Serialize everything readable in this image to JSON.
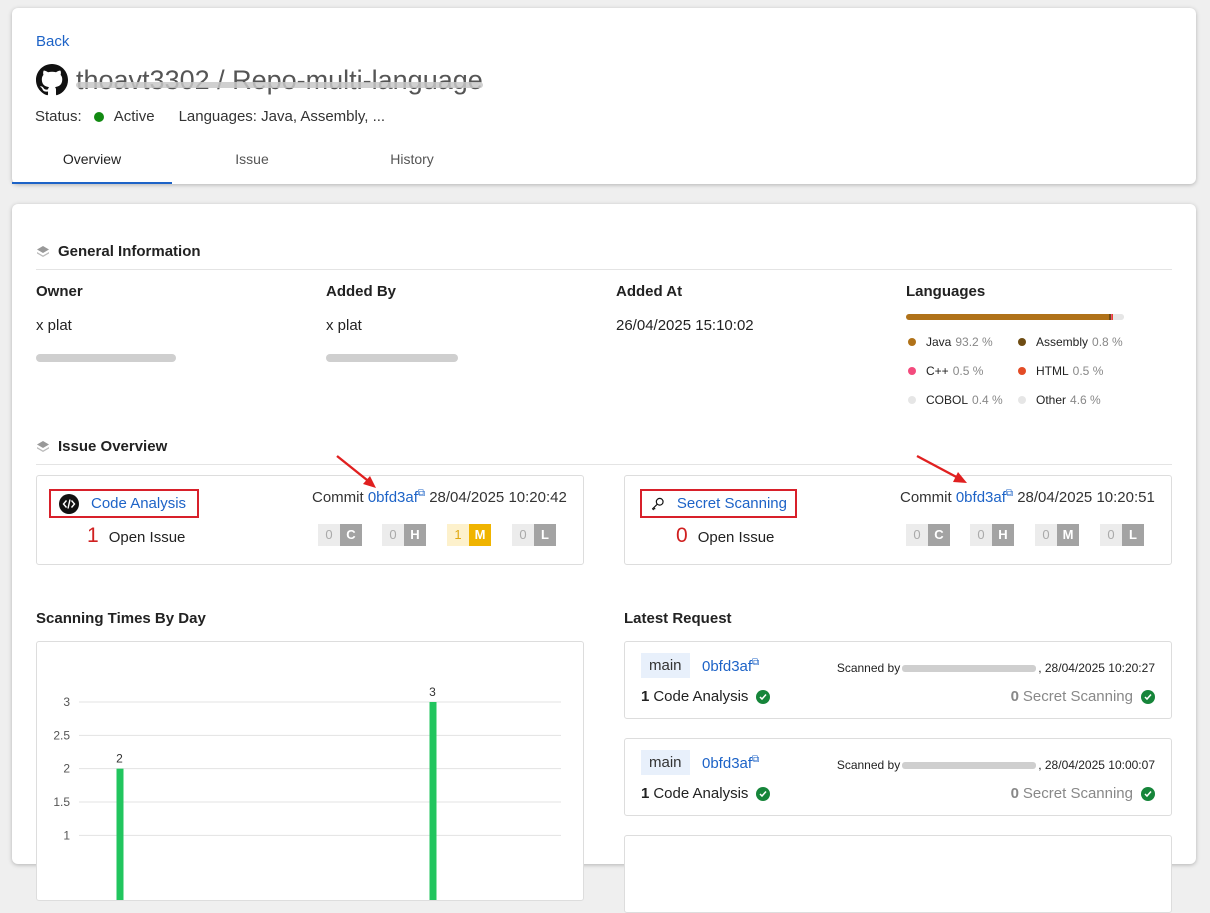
{
  "header": {
    "back_label": "Back",
    "repo_title": "thoavt3302 / Repo-multi-language",
    "status_label": "Status:",
    "status_value": "Active",
    "languages_summary": "Languages: Java, Assembly, ...",
    "tabs": [
      {
        "label": "Overview",
        "active": true
      },
      {
        "label": "Issue",
        "active": false
      },
      {
        "label": "History",
        "active": false
      }
    ]
  },
  "general": {
    "title": "General Information",
    "owner_label": "Owner",
    "owner_name": "x plat",
    "added_by_label": "Added By",
    "added_by_name": "x plat",
    "added_at_label": "Added At",
    "added_at_value": "26/04/2025 15:10:02",
    "languages_label": "Languages",
    "languages": [
      {
        "name": "Java",
        "pct": "93.2 %",
        "color": "#b07219"
      },
      {
        "name": "Assembly",
        "pct": "0.8 %",
        "color": "#6e4c13"
      },
      {
        "name": "C++",
        "pct": "0.5 %",
        "color": "#f34b7d"
      },
      {
        "name": "HTML",
        "pct": "0.5 %",
        "color": "#e34c26"
      },
      {
        "name": "COBOL",
        "pct": "0.4 %",
        "color": "#e6e6e6"
      },
      {
        "name": "Other",
        "pct": "4.6 %",
        "color": "#e6e6e6"
      }
    ]
  },
  "issue_overview": {
    "title": "Issue Overview",
    "code_analysis": {
      "title": "Code Analysis",
      "commit_label": "Commit",
      "commit_hash": "0bfd3af",
      "date": "28/04/2025 10:20:42",
      "open_count": "1",
      "open_label": "Open Issue",
      "severity": {
        "C": "0",
        "H": "0",
        "M": "1",
        "L": "0"
      }
    },
    "secret_scanning": {
      "title": "Secret Scanning",
      "commit_label": "Commit",
      "commit_hash": "0bfd3af",
      "date": "28/04/2025 10:20:51",
      "open_count": "0",
      "open_label": "Open Issue",
      "severity": {
        "C": "0",
        "H": "0",
        "M": "0",
        "L": "0"
      }
    },
    "severity_letters": {
      "C": "C",
      "H": "H",
      "M": "M",
      "L": "L"
    }
  },
  "scanning_chart": {
    "title": "Scanning Times By Day"
  },
  "chart_data": {
    "type": "bar",
    "title": "Scanning Times By Day",
    "yticks": [
      "1",
      "1.5",
      "2",
      "2.5",
      "3"
    ],
    "values": [
      2,
      3
    ],
    "value_labels": [
      "2",
      "3"
    ],
    "ylim": [
      0,
      3
    ],
    "grid": true,
    "color": "#22c55e"
  },
  "latest_request": {
    "title": "Latest Request",
    "items": [
      {
        "branch": "main",
        "commit": "0bfd3af",
        "scanned_by": "Scanned by",
        "datetime": ", 28/04/2025 10:20:27",
        "code_count": "1",
        "code_label": "Code Analysis",
        "secret_count": "0",
        "secret_label": "Secret Scanning"
      },
      {
        "branch": "main",
        "commit": "0bfd3af",
        "scanned_by": "Scanned by",
        "datetime": ", 28/04/2025 10:00:07",
        "code_count": "1",
        "code_label": "Code Analysis",
        "secret_count": "0",
        "secret_label": "Secret Scanning"
      }
    ]
  }
}
